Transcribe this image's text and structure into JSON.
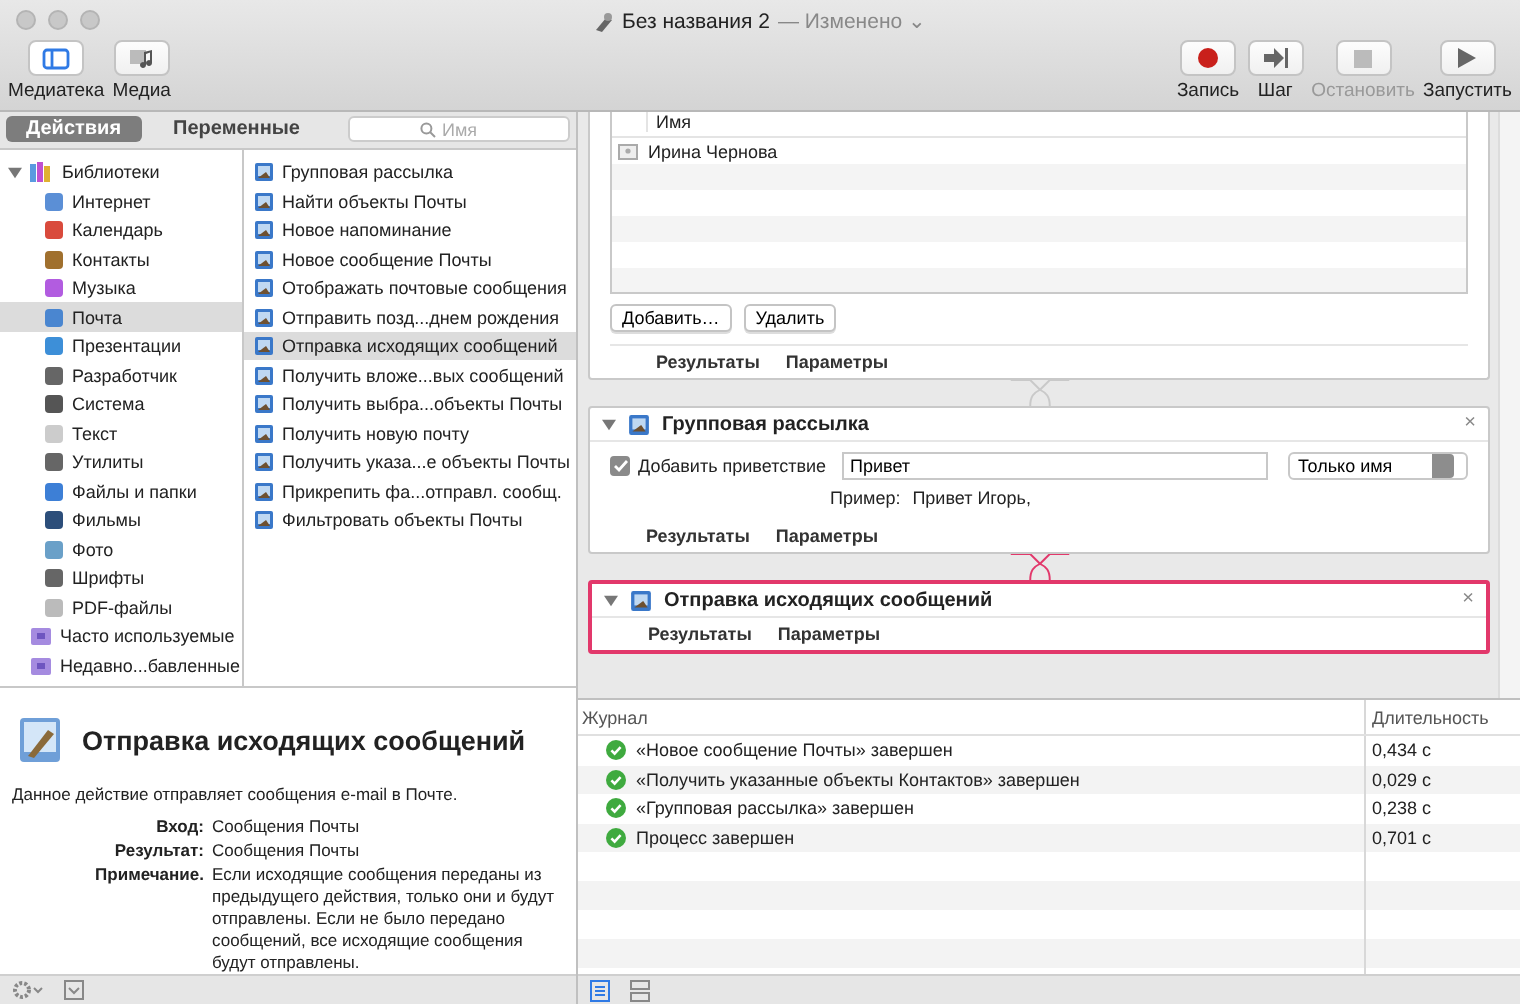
{
  "window": {
    "title": "Без названия 2",
    "status": "— Изменено",
    "status_caret": "⌄"
  },
  "toolbar": {
    "left": [
      {
        "label": "Медиатека",
        "kind": "library",
        "selected": true
      },
      {
        "label": "Медиа",
        "kind": "media",
        "selected": false
      }
    ],
    "right": [
      {
        "label": "Запись",
        "kind": "record",
        "disabled": false
      },
      {
        "label": "Шаг",
        "kind": "step",
        "disabled": false
      },
      {
        "label": "Остановить",
        "kind": "stop",
        "disabled": true
      },
      {
        "label": "Запустить",
        "kind": "run",
        "disabled": false
      }
    ]
  },
  "library": {
    "tabs": [
      {
        "label": "Действия",
        "selected": true
      },
      {
        "label": "Переменные",
        "selected": false
      }
    ],
    "search": {
      "placeholder": "Имя"
    },
    "categories": [
      {
        "label": "Библиотеки",
        "expanded": true,
        "selected": false,
        "children": [
          {
            "label": "Интернет",
            "selected": false
          },
          {
            "label": "Календарь",
            "selected": false
          },
          {
            "label": "Контакты",
            "selected": false
          },
          {
            "label": "Музыка",
            "selected": false
          },
          {
            "label": "Почта",
            "selected": true
          },
          {
            "label": "Презентации",
            "selected": false
          },
          {
            "label": "Разработчик",
            "selected": false
          },
          {
            "label": "Система",
            "selected": false
          },
          {
            "label": "Текст",
            "selected": false
          },
          {
            "label": "Утилиты",
            "selected": false
          },
          {
            "label": "Файлы и папки",
            "selected": false
          },
          {
            "label": "Фильмы",
            "selected": false
          },
          {
            "label": "Фото",
            "selected": false
          },
          {
            "label": "Шрифты",
            "selected": false
          },
          {
            "label": "PDF-файлы",
            "selected": false
          }
        ]
      },
      {
        "label": "Часто используемые",
        "selected": false
      },
      {
        "label": "Недавно...бавленные",
        "selected": false
      }
    ],
    "actions": [
      {
        "label": "Групповая рассылка",
        "selected": false
      },
      {
        "label": "Найти объекты Почты",
        "selected": false
      },
      {
        "label": "Новое напоминание",
        "selected": false
      },
      {
        "label": "Новое сообщение Почты",
        "selected": false
      },
      {
        "label": "Отображать почтовые сообщения",
        "selected": false
      },
      {
        "label": "Отправить позд...днем рождения",
        "selected": false
      },
      {
        "label": "Отправка исходящих сообщений",
        "selected": true
      },
      {
        "label": "Получить вложе...вых сообщений",
        "selected": false
      },
      {
        "label": "Получить выбра...объекты Почты",
        "selected": false
      },
      {
        "label": "Получить новую почту",
        "selected": false
      },
      {
        "label": "Получить указа...е объекты Почты",
        "selected": false
      },
      {
        "label": "Прикрепить фа...отправл. сообщ.",
        "selected": false
      },
      {
        "label": "Фильтровать объекты Почты",
        "selected": false
      }
    ]
  },
  "description": {
    "title": "Отправка исходящих сообщений",
    "summary": "Данное действие отправляет сообщения e-mail в Почте.",
    "fields": [
      {
        "label": "Вход:",
        "value": "Сообщения Почты"
      },
      {
        "label": "Результат:",
        "value": "Сообщения Почты"
      },
      {
        "label": "Примечание.",
        "value": "Если исходящие сообщения переданы из предыдущего действия, только они и будут отправлены. Если не было передано сообщений, все исходящие сообщения будут отправлены."
      }
    ]
  },
  "workflow": {
    "contacts_card": {
      "column": "Имя",
      "rows": [
        "Ирина Чернова"
      ],
      "buttons": [
        "Добавить…",
        "Удалить"
      ],
      "footer": [
        "Результаты",
        "Параметры"
      ]
    },
    "actions": [
      {
        "title": "Групповая рассылка",
        "selected": false,
        "expanded": true,
        "kind": "greeting",
        "close": "×",
        "checkbox": {
          "label": "Добавить приветствие",
          "checked": true
        },
        "field": {
          "value": "Привет"
        },
        "popup": "Только имя",
        "example_label": "Пример:",
        "example": "Привет Игорь,",
        "footer": [
          "Результаты",
          "Параметры"
        ]
      },
      {
        "title": "Отправка исходящих сообщений",
        "selected": true,
        "expanded": true,
        "kind": "plain",
        "close": "×",
        "footer": [
          "Результаты",
          "Параметры"
        ]
      }
    ]
  },
  "log": {
    "columns": [
      "Журнал",
      "Длительность"
    ],
    "rows": [
      {
        "message": "«Новое сообщение Почты» завершен",
        "duration": "0,434 с",
        "done": true
      },
      {
        "message": "«Получить указанные объекты Контактов» завершен",
        "duration": "0,029 с",
        "done": true
      },
      {
        "message": "«Групповая рассылка» завершен",
        "duration": "0,238 с",
        "done": true
      },
      {
        "message": "Процесс завершен",
        "duration": "0,701 с",
        "done": true
      }
    ]
  }
}
